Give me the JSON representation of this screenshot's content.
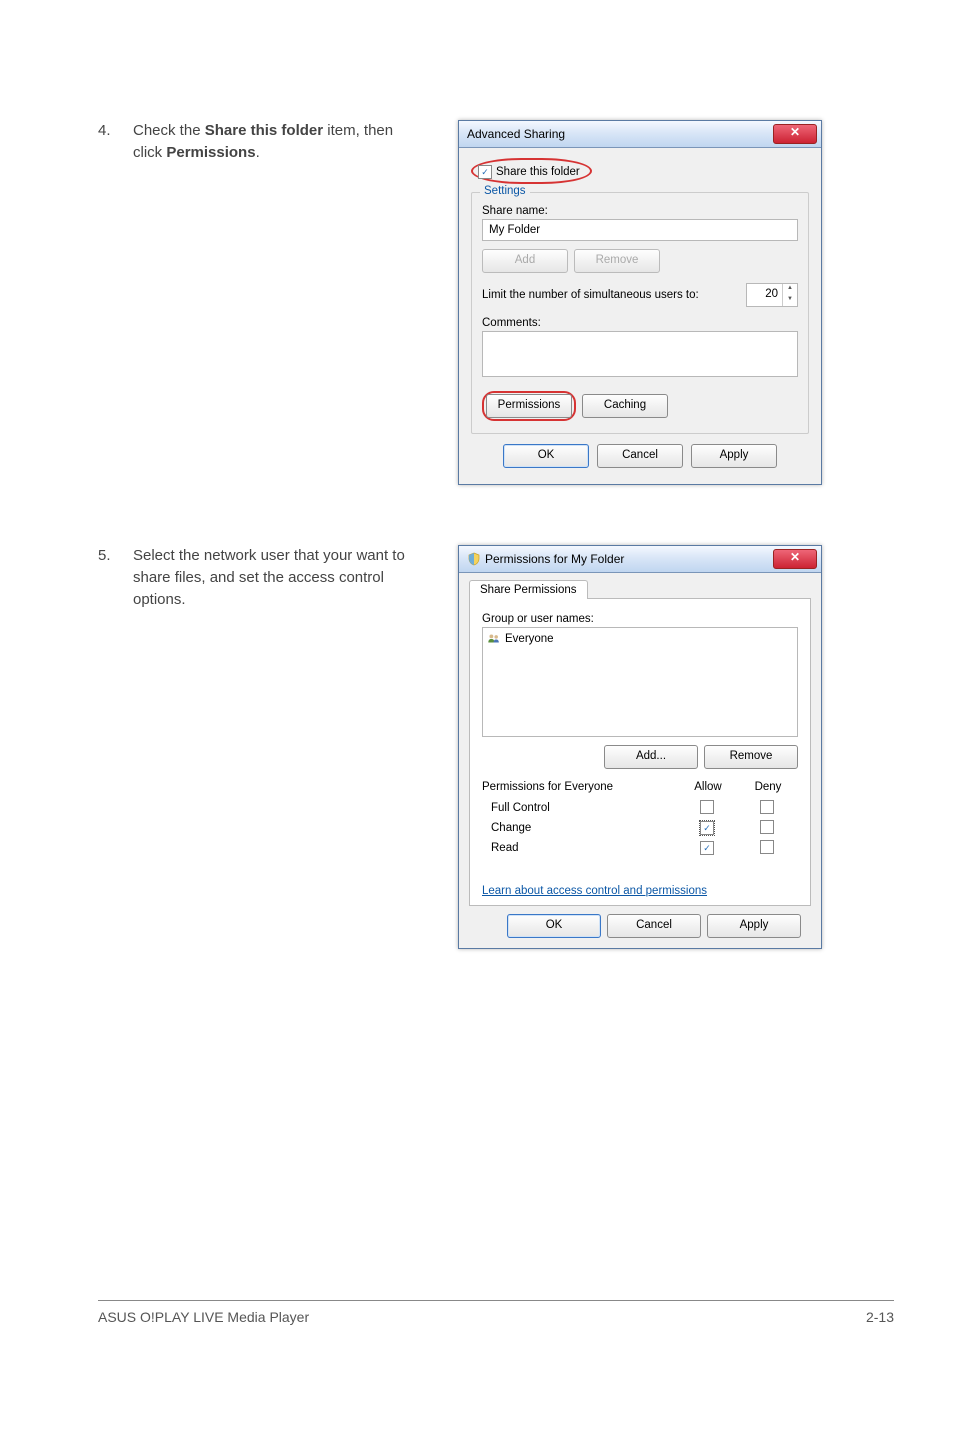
{
  "step4": {
    "num": "4.",
    "text_pre": "Check the ",
    "text_bold1": "Share this folder",
    "text_mid": " item, then click ",
    "text_bold2": "Permissions",
    "text_post": "."
  },
  "step5": {
    "num": "5.",
    "text": "Select the network user that your want to share files, and set the access control options."
  },
  "dlg1": {
    "title": "Advanced Sharing",
    "share_label": "Share this folder",
    "settings_legend": "Settings",
    "share_name_label": "Share name:",
    "share_name_value": "My Folder",
    "add_btn": "Add",
    "remove_btn": "Remove",
    "limit_label": "Limit the number of simultaneous users to:",
    "limit_value": "20",
    "comments_label": "Comments:",
    "permissions_btn": "Permissions",
    "caching_btn": "Caching",
    "ok": "OK",
    "cancel": "Cancel",
    "apply": "Apply"
  },
  "dlg2": {
    "title": "Permissions for My Folder",
    "tab": "Share Permissions",
    "group_label": "Group or user names:",
    "user0": "Everyone",
    "add_btn": "Add...",
    "remove_btn": "Remove",
    "perm_header": "Permissions for Everyone",
    "allow": "Allow",
    "deny": "Deny",
    "perm_full": "Full Control",
    "perm_change": "Change",
    "perm_read": "Read",
    "learn_link": "Learn about access control and permissions",
    "ok": "OK",
    "cancel": "Cancel",
    "apply": "Apply"
  },
  "footer": {
    "left": "ASUS O!PLAY LIVE Media Player",
    "right": "2-13"
  },
  "chart_data": null
}
